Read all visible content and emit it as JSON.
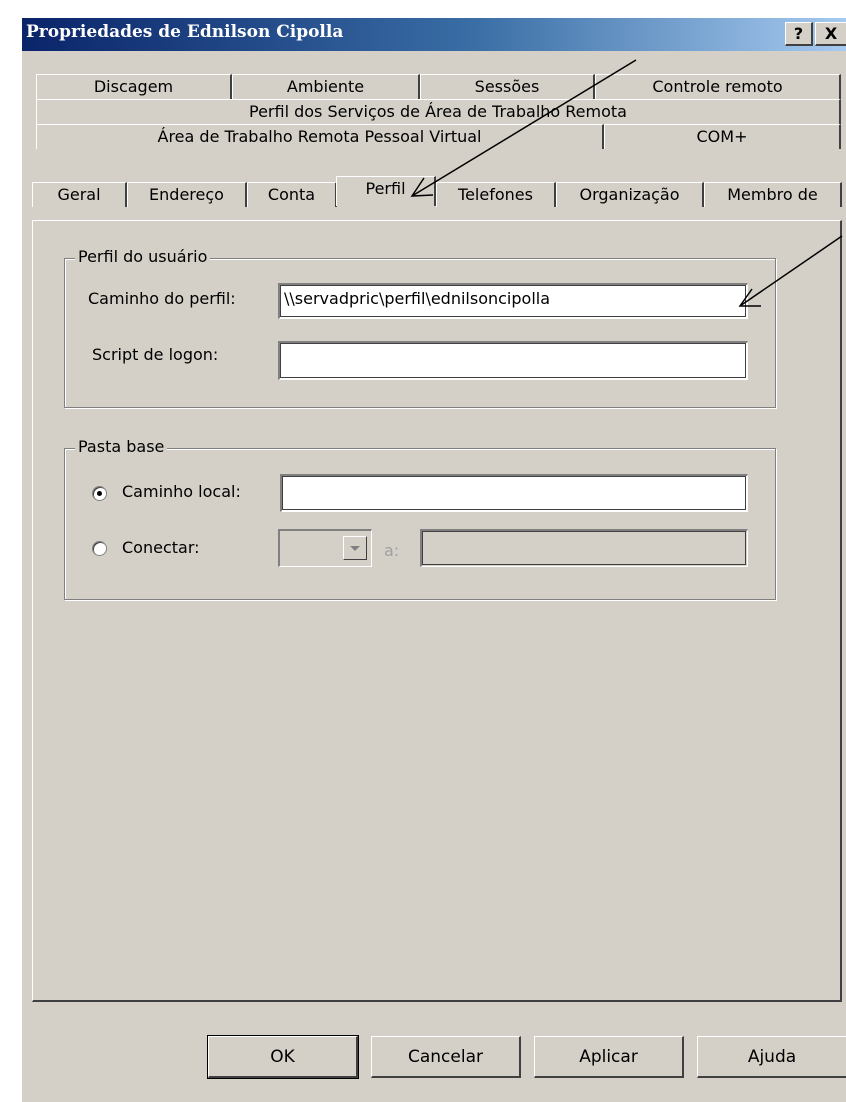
{
  "window": {
    "title": "Propriedades de Ednilson Cipolla",
    "help_glyph": "?",
    "close_glyph": "X"
  },
  "tabs": {
    "row1": [
      "Discagem",
      "Ambiente",
      "Sessões",
      "Controle remoto"
    ],
    "row2": [
      "Perfil dos Serviços de Área de Trabalho Remota"
    ],
    "row3": [
      "Área de Trabalho Remota Pessoal Virtual",
      "COM+"
    ],
    "row4": [
      "Geral",
      "Endereço",
      "Conta",
      "Perfil",
      "Telefones",
      "Organização",
      "Membro de"
    ],
    "active": "Perfil"
  },
  "user_profile": {
    "legend": "Perfil do usuário",
    "profile_path_label": "Caminho do perfil:",
    "profile_path_value": "\\\\servadpric\\perfil\\ednilsoncipolla",
    "logon_script_label": "Script de logon:",
    "logon_script_value": ""
  },
  "home_folder": {
    "legend": "Pasta base",
    "local_path_label": "Caminho local:",
    "local_path_value": "",
    "local_path_selected": true,
    "connect_label": "Conectar:",
    "connect_selected": false,
    "drive_value": "",
    "to_label": "a:",
    "connect_path_value": ""
  },
  "buttons": {
    "ok": "OK",
    "cancel": "Cancelar",
    "apply": "Aplicar",
    "help": "Ajuda"
  },
  "colors": {
    "titlebar_start": "#0a246a",
    "titlebar_end": "#a6caf0",
    "dialog_bg": "#d4d0c8"
  }
}
